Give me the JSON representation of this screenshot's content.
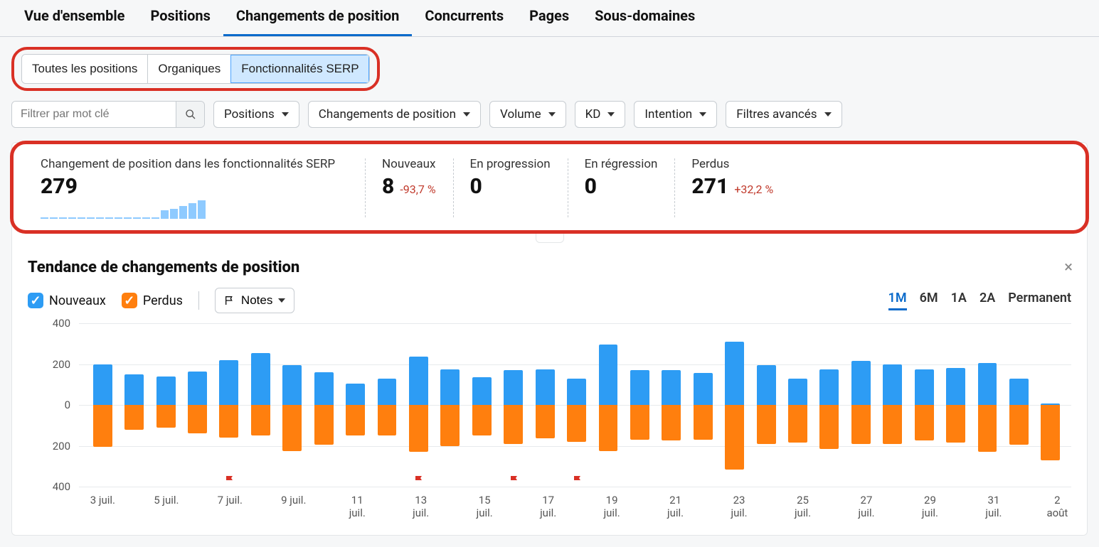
{
  "main_tabs": [
    {
      "label": "Vue d'ensemble",
      "active": false
    },
    {
      "label": "Positions",
      "active": false
    },
    {
      "label": "Changements de position",
      "active": true
    },
    {
      "label": "Concurrents",
      "active": false
    },
    {
      "label": "Pages",
      "active": false
    },
    {
      "label": "Sous-domaines",
      "active": false
    }
  ],
  "sub_tabs": [
    {
      "label": "Toutes les positions",
      "active": false
    },
    {
      "label": "Organiques",
      "active": false
    },
    {
      "label": "Fonctionnalités SERP",
      "active": true
    }
  ],
  "filters": {
    "keyword_placeholder": "Filtrer par mot clé",
    "chips": [
      "Positions",
      "Changements de position",
      "Volume",
      "KD",
      "Intention",
      "Filtres avancés"
    ]
  },
  "metrics": [
    {
      "label": "Changement de position dans les fonctionnalités SERP",
      "value": "279",
      "delta": "",
      "spark_bars": [
        2,
        2,
        12,
        14,
        18,
        22,
        26
      ],
      "spark_line_count": 11
    },
    {
      "label": "Nouveaux",
      "value": "8",
      "delta": "-93,7 %"
    },
    {
      "label": "En progression",
      "value": "0",
      "delta": ""
    },
    {
      "label": "En régression",
      "value": "0",
      "delta": ""
    },
    {
      "label": "Perdus",
      "value": "271",
      "delta": "+32,2 %"
    }
  ],
  "trend": {
    "title": "Tendance de changements de position",
    "legend_new": "Nouveaux",
    "legend_lost": "Perdus",
    "notes_label": "Notes",
    "close_label": "×",
    "ranges": [
      {
        "label": "1M",
        "active": true
      },
      {
        "label": "6M",
        "active": false
      },
      {
        "label": "1A",
        "active": false
      },
      {
        "label": "2A",
        "active": false
      },
      {
        "label": "Permanent",
        "active": false
      }
    ]
  },
  "chart_data": {
    "type": "bar",
    "title": "Tendance de changements de position",
    "xlabel": "",
    "ylabel": "",
    "ylim": [
      -400,
      400
    ],
    "y_ticks": [
      400,
      200,
      0,
      200,
      400
    ],
    "categories": [
      "3 juil.",
      "4 juil.",
      "5 juil.",
      "6 juil.",
      "7 juil.",
      "8 juil.",
      "9 juil.",
      "10 juil.",
      "11 juil.",
      "12 juil.",
      "13 juil.",
      "14 juil.",
      "15 juil.",
      "16 juil.",
      "17 juil.",
      "18 juil.",
      "19 juil.",
      "20 juil.",
      "21 juil.",
      "22 juil.",
      "23 juil.",
      "24 juil.",
      "25 juil.",
      "26 juil.",
      "27 juil.",
      "28 juil.",
      "29 juil.",
      "30 juil.",
      "31 juil.",
      "1 août",
      "2 août"
    ],
    "x_tick_labels": [
      "3 juil.",
      "5 juil.",
      "7 juil.",
      "9 juil.",
      "11 juil.",
      "13 juil.",
      "15 juil.",
      "17 juil.",
      "19 juil.",
      "21 juil.",
      "23 juil.",
      "25 juil.",
      "27 juil.",
      "29 juil.",
      "31 juil.",
      "2 août"
    ],
    "series": [
      {
        "name": "Nouveaux",
        "color": "#2d9cf4",
        "values": [
          200,
          150,
          140,
          165,
          220,
          255,
          195,
          160,
          105,
          130,
          235,
          175,
          135,
          170,
          175,
          130,
          295,
          170,
          170,
          155,
          310,
          195,
          130,
          175,
          215,
          200,
          175,
          180,
          205,
          130,
          8
        ]
      },
      {
        "name": "Perdus",
        "color": "#ff7f0e",
        "values": [
          205,
          120,
          110,
          140,
          160,
          150,
          225,
          195,
          150,
          150,
          230,
          200,
          150,
          190,
          165,
          180,
          225,
          170,
          175,
          170,
          315,
          190,
          185,
          215,
          190,
          190,
          175,
          185,
          230,
          195,
          270
        ]
      }
    ],
    "note_flags_at": [
      "7 juil.",
      "13 juil.",
      "16 juil.",
      "18 juil."
    ]
  },
  "colors": {
    "accent": "#0b6bcb",
    "blue": "#2d9cf4",
    "orange": "#ff7f0e",
    "highlight": "#d93025"
  }
}
